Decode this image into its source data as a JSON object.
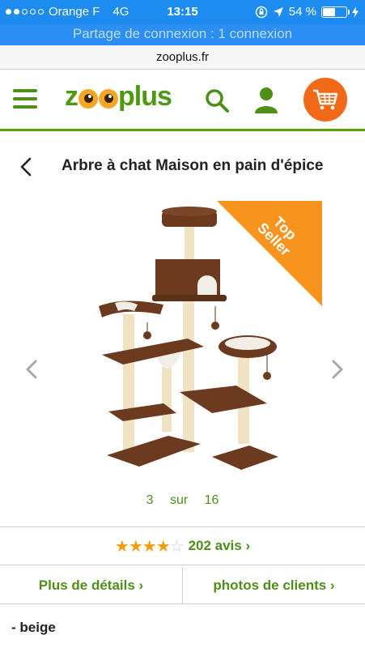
{
  "status_bar": {
    "carrier": "Orange F",
    "network": "4G",
    "time": "13:15",
    "battery": "54 %",
    "battery_level": 0.54,
    "icons": [
      "signal-dots-icon",
      "lock-rotation-icon",
      "location-arrow-icon",
      "battery-icon",
      "charging-icon"
    ]
  },
  "hotspot": {
    "text": "Partage de connexion : 1 connexion"
  },
  "browser": {
    "url": "zooplus.fr"
  },
  "header": {
    "logo_parts": [
      "z",
      "plus"
    ],
    "icons": [
      "menu-icon",
      "search-icon",
      "user-icon",
      "cart-icon"
    ],
    "colors": {
      "brand_green": "#4d9a12",
      "cart_orange": "#f26a18",
      "status_blue": "#1d8cf0"
    }
  },
  "product": {
    "title": "Arbre à chat Maison en pain d'épice",
    "badge": "Top Seller",
    "badge_color": "#f7941d"
  },
  "gallery": {
    "current": "3",
    "separator": "sur",
    "total": "16"
  },
  "reviews": {
    "rating": 4,
    "max": 5,
    "label": "202 avis ›"
  },
  "tabs": [
    {
      "label": "Plus de détails ›"
    },
    {
      "label": "photos de clients ›"
    }
  ],
  "variant": {
    "label": "- beige"
  }
}
